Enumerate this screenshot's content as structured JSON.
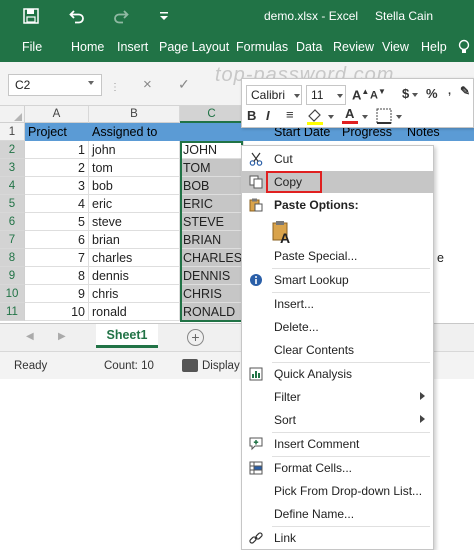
{
  "titlebar": {
    "filename": "demo.xlsx",
    "separator": "-",
    "app": "Excel",
    "user": "Stella Cain"
  },
  "ribbon": {
    "tabs": [
      "File",
      "Home",
      "Insert",
      "Page Layout",
      "Formulas",
      "Data",
      "Review",
      "View",
      "Help"
    ]
  },
  "formula_bar": {
    "name_box": "C2",
    "cancel_symbol": "×",
    "enter_symbol": "✓",
    "watermark": "top-password.com"
  },
  "grid": {
    "column_headers": [
      "A",
      "B",
      "C"
    ],
    "header_row": [
      "Project",
      "Assigned to",
      "",
      "Start Date",
      "Progress",
      "Notes"
    ],
    "row_numbers": [
      "1",
      "2",
      "3",
      "4",
      "5",
      "6",
      "7",
      "8",
      "9",
      "10",
      "11"
    ],
    "rows": [
      {
        "a": "1",
        "b": "john",
        "c": "JOHN"
      },
      {
        "a": "2",
        "b": "tom",
        "c": "TOM"
      },
      {
        "a": "3",
        "b": "bob",
        "c": "BOB"
      },
      {
        "a": "4",
        "b": "eric",
        "c": "ERIC"
      },
      {
        "a": "5",
        "b": "steve",
        "c": "STEVE"
      },
      {
        "a": "6",
        "b": "brian",
        "c": "BRIAN"
      },
      {
        "a": "7",
        "b": "charles",
        "c": "CHARLES"
      },
      {
        "a": "8",
        "b": "dennis",
        "c": "DENNIS"
      },
      {
        "a": "9",
        "b": "chris",
        "c": "CHRIS"
      },
      {
        "a": "10",
        "b": "ronald",
        "c": "RONALD"
      }
    ],
    "partial_e8": "e"
  },
  "sheets": {
    "active": "Sheet1",
    "add_symbol": "+"
  },
  "status": {
    "ready": "Ready",
    "count": "Count: 10",
    "display": "Display"
  },
  "mini_toolbar": {
    "font": "Calibri",
    "size": "11",
    "currency": "$",
    "percent": "%",
    "bold": "B",
    "italic": "I",
    "align": "≡",
    "font_color_letter": "A"
  },
  "context_menu": {
    "cut": "Cut",
    "copy": "Copy",
    "paste_options": "Paste Options:",
    "paste_special": "Paste Special...",
    "smart_lookup": "Smart Lookup",
    "insert": "Insert...",
    "delete": "Delete...",
    "clear_contents": "Clear Contents",
    "quick_analysis": "Quick Analysis",
    "filter": "Filter",
    "sort": "Sort",
    "insert_comment": "Insert Comment",
    "format_cells": "Format Cells...",
    "pick_dropdown": "Pick From Drop-down List...",
    "define_name": "Define Name...",
    "link": "Link"
  },
  "colors": {
    "excel_green": "#217346",
    "header_blue": "#5b9bd5",
    "highlight_red": "#e02020"
  }
}
